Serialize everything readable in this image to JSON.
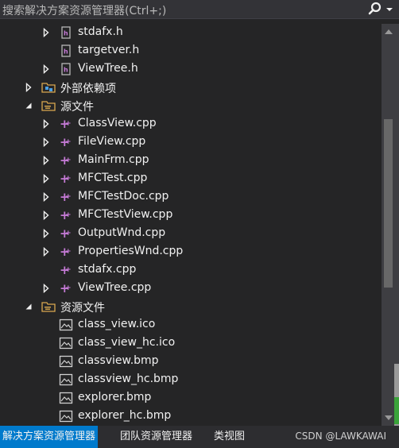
{
  "search": {
    "placeholder": "搜索解决方案资源管理器(Ctrl+;)"
  },
  "tree": [
    {
      "label": "stdafx.h",
      "icon": "header-file-icon",
      "expander": "collapsed",
      "indent": 2
    },
    {
      "label": "targetver.h",
      "icon": "header-file-icon",
      "expander": "none",
      "indent": 2
    },
    {
      "label": "ViewTree.h",
      "icon": "header-file-icon",
      "expander": "collapsed",
      "indent": 2
    },
    {
      "label": "外部依赖项",
      "icon": "external-dependencies-icon",
      "expander": "collapsed",
      "indent": 1
    },
    {
      "label": "源文件",
      "icon": "filter-folder-icon",
      "expander": "expanded",
      "indent": 1
    },
    {
      "label": "ClassView.cpp",
      "icon": "cpp-file-icon",
      "expander": "collapsed",
      "indent": 2
    },
    {
      "label": "FileView.cpp",
      "icon": "cpp-file-icon",
      "expander": "collapsed",
      "indent": 2
    },
    {
      "label": "MainFrm.cpp",
      "icon": "cpp-file-icon",
      "expander": "collapsed",
      "indent": 2
    },
    {
      "label": "MFCTest.cpp",
      "icon": "cpp-file-icon",
      "expander": "collapsed",
      "indent": 2
    },
    {
      "label": "MFCTestDoc.cpp",
      "icon": "cpp-file-icon",
      "expander": "collapsed",
      "indent": 2
    },
    {
      "label": "MFCTestView.cpp",
      "icon": "cpp-file-icon",
      "expander": "collapsed",
      "indent": 2
    },
    {
      "label": "OutputWnd.cpp",
      "icon": "cpp-file-icon",
      "expander": "collapsed",
      "indent": 2
    },
    {
      "label": "PropertiesWnd.cpp",
      "icon": "cpp-file-icon",
      "expander": "collapsed",
      "indent": 2
    },
    {
      "label": "stdafx.cpp",
      "icon": "cpp-file-icon",
      "expander": "none",
      "indent": 2
    },
    {
      "label": "ViewTree.cpp",
      "icon": "cpp-file-icon",
      "expander": "collapsed",
      "indent": 2
    },
    {
      "label": "资源文件",
      "icon": "filter-folder-icon",
      "expander": "expanded",
      "indent": 1
    },
    {
      "label": "class_view.ico",
      "icon": "image-file-icon",
      "expander": "none",
      "indent": 2
    },
    {
      "label": "class_view_hc.ico",
      "icon": "image-file-icon",
      "expander": "none",
      "indent": 2
    },
    {
      "label": "classview.bmp",
      "icon": "image-file-icon",
      "expander": "none",
      "indent": 2
    },
    {
      "label": "classview_hc.bmp",
      "icon": "image-file-icon",
      "expander": "none",
      "indent": 2
    },
    {
      "label": "explorer.bmp",
      "icon": "image-file-icon",
      "expander": "none",
      "indent": 2
    },
    {
      "label": "explorer_hc.bmp",
      "icon": "image-file-icon",
      "expander": "none",
      "indent": 2
    }
  ],
  "tabs": [
    "解决方案资源管理器",
    "团队资源管理器",
    "类视图"
  ],
  "active_tab": 0,
  "watermark": "CSDN @LAWKAWAI",
  "colors": {
    "accent": "#007acc",
    "cpp_icon": "#c57ad6",
    "folder_icon": "#d9a84f"
  }
}
